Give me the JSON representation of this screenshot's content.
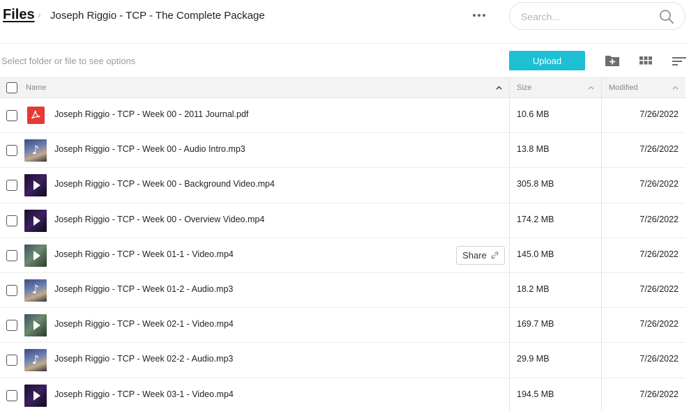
{
  "header": {
    "root_link": "Files",
    "separator": "›",
    "folder_title": "Joseph Riggio - TCP - The Complete Package"
  },
  "search": {
    "placeholder": "Search..."
  },
  "toolbar": {
    "hint": "Select folder or file to see options",
    "upload_label": "Upload"
  },
  "table": {
    "columns": {
      "name": "Name",
      "size": "Size",
      "modified": "Modified"
    },
    "share_label": "Share",
    "rows": [
      {
        "name": "Joseph Riggio - TCP - Week 00 - 2011 Journal.pdf",
        "size": "10.6 MB",
        "modified": "7/26/2022",
        "kind": "pdf"
      },
      {
        "name": "Joseph Riggio - TCP - Week 00 - Audio Intro.mp3",
        "size": "13.8 MB",
        "modified": "7/26/2022",
        "kind": "audio"
      },
      {
        "name": "Joseph Riggio - TCP - Week 00 - Background Video.mp4",
        "size": "305.8 MB",
        "modified": "7/26/2022",
        "kind": "video1"
      },
      {
        "name": "Joseph Riggio - TCP - Week 00 - Overview Video.mp4",
        "size": "174.2 MB",
        "modified": "7/26/2022",
        "kind": "video1"
      },
      {
        "name": "Joseph Riggio - TCP - Week 01-1 - Video.mp4",
        "size": "145.0 MB",
        "modified": "7/26/2022",
        "kind": "video2",
        "hovered": true
      },
      {
        "name": "Joseph Riggio - TCP - Week 01-2 - Audio.mp3",
        "size": "18.2 MB",
        "modified": "7/26/2022",
        "kind": "audio"
      },
      {
        "name": "Joseph Riggio - TCP - Week 02-1 - Video.mp4",
        "size": "169.7 MB",
        "modified": "7/26/2022",
        "kind": "video2"
      },
      {
        "name": "Joseph Riggio - TCP - Week 02-2 - Audio.mp3",
        "size": "29.9 MB",
        "modified": "7/26/2022",
        "kind": "audio"
      },
      {
        "name": "Joseph Riggio - TCP - Week 03-1 - Video.mp4",
        "size": "194.5 MB",
        "modified": "7/26/2022",
        "kind": "video1"
      }
    ]
  },
  "colors": {
    "accent": "#1dbfd3",
    "pdf_red": "#e53935",
    "header_bg": "#f3f3f3"
  }
}
